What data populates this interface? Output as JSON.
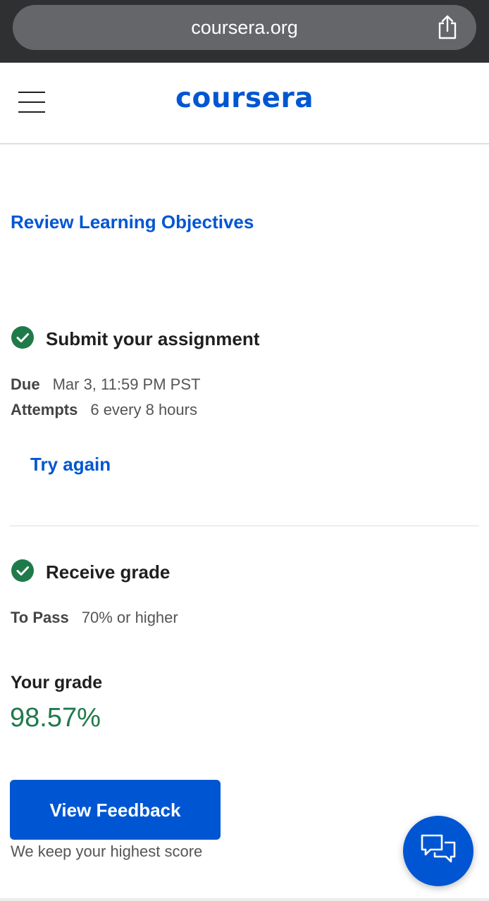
{
  "browser": {
    "url": "coursera.org"
  },
  "header": {
    "logo_text": "coursera"
  },
  "review_link": "Review Learning Objectives",
  "submit_section": {
    "title": "Submit your assignment",
    "due_label": "Due",
    "due_value": "Mar 3, 11:59 PM PST",
    "attempts_label": "Attempts",
    "attempts_value": "6 every 8 hours",
    "try_again": "Try again"
  },
  "grade_section": {
    "title": "Receive grade",
    "pass_label": "To Pass",
    "pass_value": "70% or higher",
    "your_grade_label": "Your grade",
    "your_grade_value": "98.57%",
    "view_feedback_button": "View Feedback",
    "footnote": "We keep your highest score"
  },
  "colors": {
    "brand": "#0056d2",
    "success": "#1f7a4a"
  },
  "icons": {
    "share": "share-icon",
    "menu": "menu-icon",
    "check": "check-circle-icon",
    "chat": "chat-bubbles-icon"
  }
}
